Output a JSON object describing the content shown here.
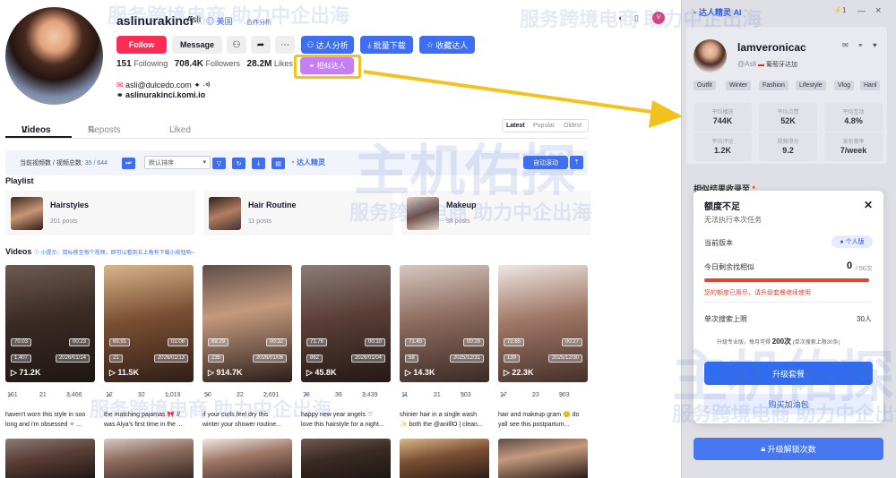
{
  "profile": {
    "username": "aslinurakinci",
    "nickname": "Asli",
    "country": "美国",
    "coop": "合作分析",
    "follow": "Follow",
    "message": "Message",
    "more_icon": "ellipsis-icon",
    "analysis": "达人分析",
    "batch_download": "批量下载",
    "collect": "收藏达人",
    "similar": "相似达人",
    "following_count": "151",
    "following_label": "Following",
    "followers_count": "708.4K",
    "followers_label": "Followers",
    "likes_count": "28.2M",
    "likes_label": "Likes",
    "email": "asli@dulcedo.com ✦ ·ᢀ",
    "link": "aslinurakinci.komi.io"
  },
  "tabs": {
    "videos": "Videos",
    "reposts": "Reposts",
    "liked": "Liked"
  },
  "sort": {
    "latest": "Latest",
    "popular": "Popular",
    "oldest": "Oldest"
  },
  "toolbar": {
    "progress_label": "当前视频数 / 视频总数:",
    "progress_value": "35 / 644",
    "sort_select": "默认排序",
    "brand": "达人精灵",
    "auto_scroll": "自动滚动"
  },
  "playlists": {
    "title": "Playlist",
    "items": [
      {
        "name": "Hairstyles",
        "count": "201 posts"
      },
      {
        "name": "Hair Routine",
        "count": "11 posts"
      },
      {
        "name": "Makeup",
        "count": "98 posts"
      }
    ]
  },
  "videos": {
    "title": "Videos",
    "tip": "小提示：鼠标移至每个视频，即可以看到右上角有下载小按钮哟~",
    "items": [
      {
        "eng": "70.03",
        "dur": "00:23",
        "saves": "1,407",
        "date": "2026/01/14",
        "views": "71.2K",
        "shares": "161",
        "comments": "21",
        "likes": "3,466",
        "caption1": "haven't worn this style in soo",
        "caption2": "long and i'm obsessed ✧ ..."
      },
      {
        "eng": "69.91",
        "dur": "01:08",
        "saves": "21",
        "date": "2026/01/13",
        "views": "11.5K",
        "shares": "12",
        "comments": "32",
        "likes": "1,019",
        "caption1": "the matching pajamas 🎀 //",
        "caption2": "was Alya's first time in the ..."
      },
      {
        "eng": "69.29",
        "dur": "00:32",
        "saves": "235",
        "date": "2026/01/06",
        "views": "914.7K",
        "shares": "50",
        "comments": "22",
        "likes": "2,691",
        "caption1": "if your curls feel dry this",
        "caption2": "winter your shower routine..."
      },
      {
        "eng": "71.76",
        "dur": "00:10",
        "saves": "862",
        "date": "2026/01/04",
        "views": "45.8K",
        "shares": "78",
        "comments": "39",
        "likes": "3,439",
        "caption1": "happy new year angels ♡",
        "caption2": "love this hairstyle for a night..."
      },
      {
        "eng": "71.45",
        "dur": "00:28",
        "saves": "58",
        "date": "2025/12/31",
        "views": "14.3K",
        "shares": "11",
        "comments": "21",
        "likes": "503",
        "caption1": "shinier hair in a single wash",
        "caption2": "✨ both the @anilllO | clean..."
      },
      {
        "eng": "72.65",
        "dur": "00:27",
        "saves": "139",
        "date": "2025/12/30",
        "views": "22.3K",
        "shares": "17",
        "comments": "23",
        "likes": "903",
        "caption1": "hair and makeup gram 😊 do",
        "caption2": "yall see this postpartum..."
      }
    ]
  },
  "panel": {
    "title": "达人精灵 AI",
    "count": "1",
    "name": "lamveronicac",
    "handle": "@Asli",
    "country": "葡萄牙达加",
    "tags": [
      "Outfit",
      "Winter",
      "Fashion",
      "Lifestyle",
      "Vlog",
      "Hanl"
    ],
    "stats": [
      {
        "label": "平均播放",
        "value": "744K"
      },
      {
        "label": "平均点赞",
        "value": "52K"
      },
      {
        "label": "平均互动",
        "value": "4.8%"
      },
      {
        "label": "平均评论",
        "value": "1.2K"
      },
      {
        "label": "视频得分",
        "value": "9.2"
      },
      {
        "label": "发布频率",
        "value": "7/week"
      }
    ],
    "collect_to": "相似结果收录至"
  },
  "dialog": {
    "title": "额度不足",
    "subtitle": "无法执行本次任务",
    "plan_label": "当前版本",
    "plan_badge": "● 个人版",
    "remaining_label": "今日剩余找相似",
    "remaining": "0",
    "limit": "/ 50次",
    "warning": "您的额度已用尽，请升级套餐继续使用",
    "search_limit_label": "单次搜索上限",
    "search_limit": "30人",
    "upgrade_note_pre": "升级专业版，每月可得",
    "upgrade_note_num": "200次",
    "upgrade_note_post": "(单次搜索上限30条)",
    "upgrade": "升级套餐",
    "buy": "购买加油包",
    "unlock": "升级解锁次数",
    "remaining_fraction": 0
  },
  "watermark": {
    "line1": "主机佑探",
    "line2": "服务跨境电商 助力中企出海"
  },
  "colors": {
    "follow": "#fe2c55",
    "accent": "#3f6ff0",
    "similar": "#c67ef7",
    "warn": "#e8442d"
  }
}
